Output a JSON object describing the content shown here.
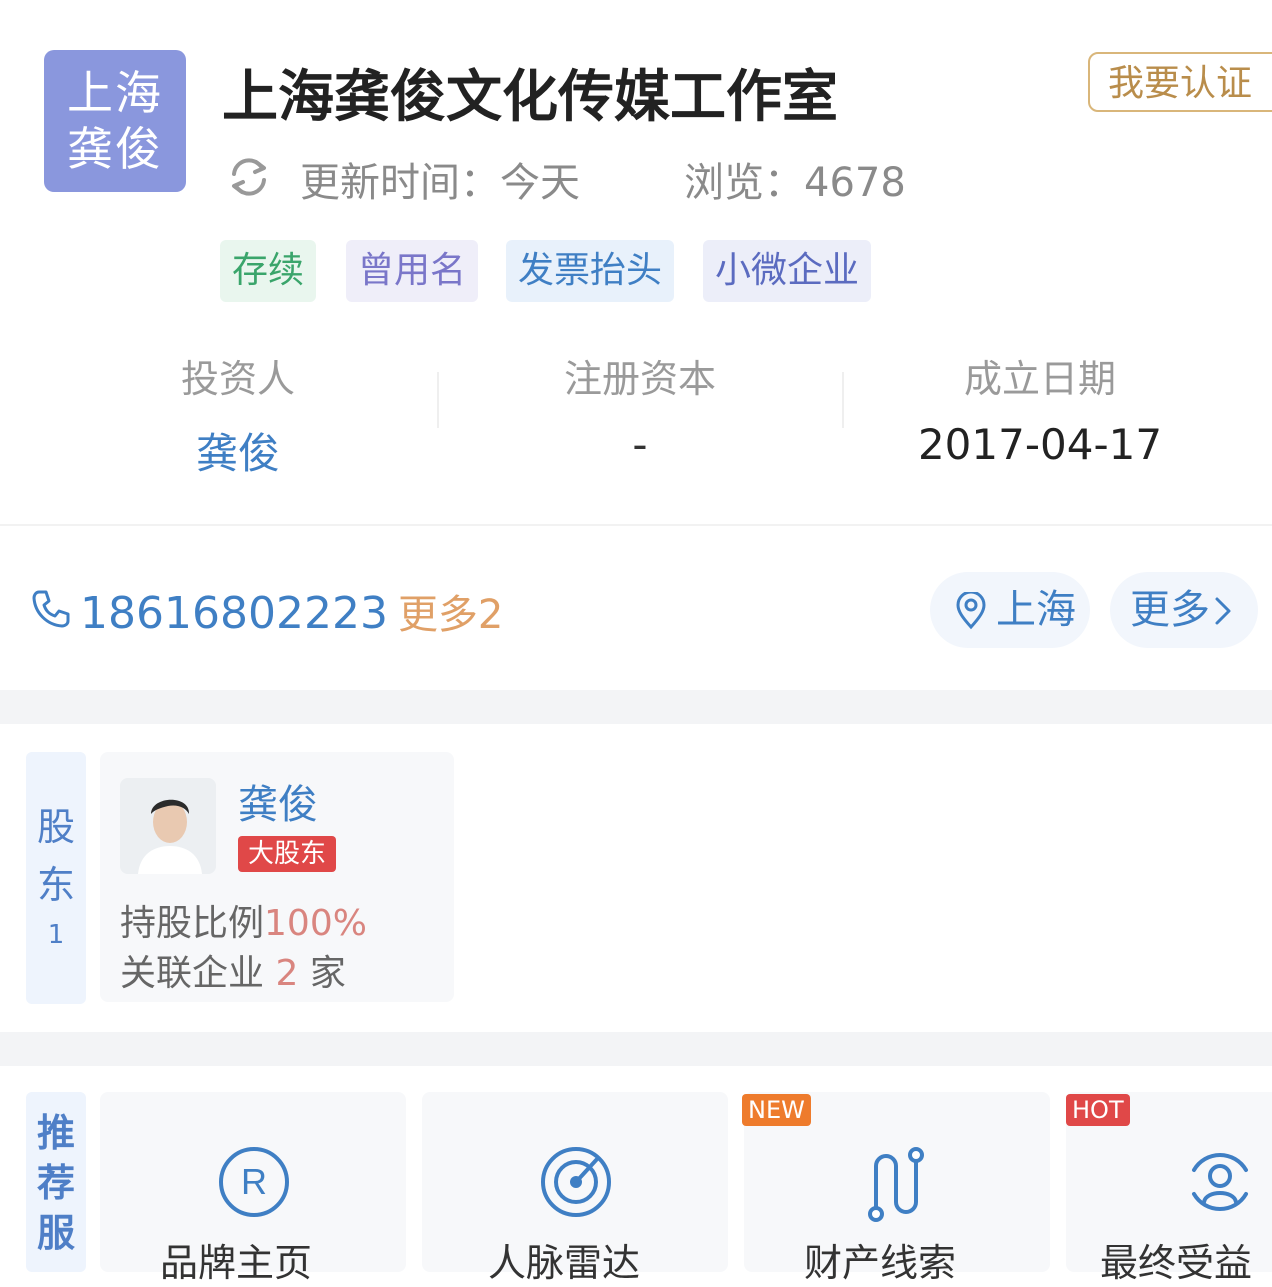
{
  "company": {
    "logo_text": [
      "上海",
      "龚俊"
    ],
    "name": "上海龚俊文化传媒工作室",
    "certify_button": "我要认证",
    "update_label": "更新时间：",
    "update_value": "今天",
    "views_label": "浏览：",
    "views_value": "4678"
  },
  "tags": [
    {
      "label": "存续",
      "color": "#3aa56b",
      "bg": "#e9f6ee"
    },
    {
      "label": "曾用名",
      "color": "#7a76c9",
      "bg": "#efeef9"
    },
    {
      "label": "发票抬头",
      "color": "#3f7fc4",
      "bg": "#e8f1fb"
    },
    {
      "label": "小微企业",
      "color": "#5b6bc0",
      "bg": "#eceef9"
    }
  ],
  "summary": {
    "investor_label": "投资人",
    "investor_value": "龚俊",
    "capital_label": "注册资本",
    "capital_value": "-",
    "date_label": "成立日期",
    "date_value": "2017-04-17"
  },
  "contact": {
    "phone": "18616802223",
    "more_phone": "更多2",
    "location": "上海",
    "more": "更多"
  },
  "shareholders": {
    "side_label": [
      "股",
      "东"
    ],
    "count": "1",
    "name": "龚俊",
    "badge": "大股东",
    "ratio_label": "持股比例",
    "ratio_value": "100%",
    "related_label": "关联企业",
    "related_value": "2",
    "related_unit": "家"
  },
  "services": {
    "side_label": [
      "推",
      "荐",
      "服"
    ],
    "items": [
      {
        "label": "品牌主页",
        "icon": "registered-icon",
        "badge": ""
      },
      {
        "label": "人脉雷达",
        "icon": "radar-icon",
        "badge": ""
      },
      {
        "label": "财产线索",
        "icon": "route-icon",
        "badge": "NEW"
      },
      {
        "label": "最终受益",
        "icon": "person-circle-icon",
        "badge": "HOT"
      }
    ]
  },
  "colors": {
    "accent": "#3f7fc4",
    "gold": "#b98d4b",
    "red": "#e04848",
    "orange": "#ee7b2c"
  }
}
